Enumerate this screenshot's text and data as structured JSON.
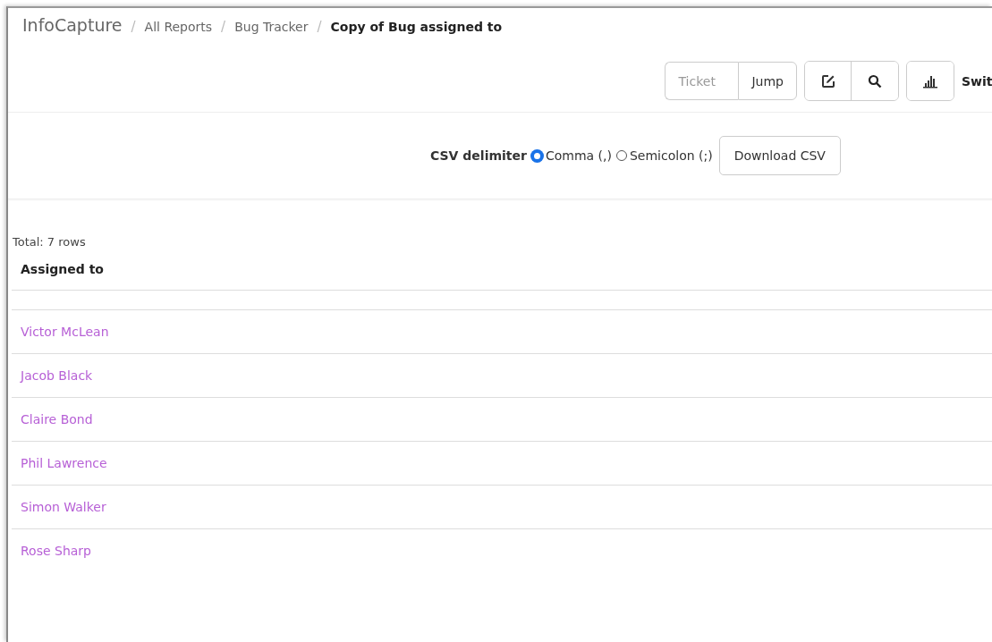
{
  "breadcrumb": [
    {
      "label": "InfoCapture",
      "kind": "brand"
    },
    {
      "label": "All Reports",
      "kind": "link"
    },
    {
      "label": "Bug Tracker",
      "kind": "link"
    },
    {
      "label": "Copy of Bug assigned to",
      "kind": "current"
    }
  ],
  "breadcrumb_separator": "/",
  "toolbar": {
    "ticket_placeholder": "Ticket",
    "jump_button": "Jump",
    "switch_label": "Swit"
  },
  "csv": {
    "label": "CSV delimiter",
    "options": [
      {
        "label": "Comma (,)",
        "selected": true
      },
      {
        "label": "Semicolon (;)",
        "selected": false
      }
    ],
    "download_button": "Download CSV"
  },
  "total": "Total: 7 rows",
  "table": {
    "columns": [
      "Assigned to"
    ],
    "rows": [
      {
        "assigned_to": "Victor McLean"
      },
      {
        "assigned_to": "Jacob Black"
      },
      {
        "assigned_to": "Claire Bond"
      },
      {
        "assigned_to": "Phil Lawrence"
      },
      {
        "assigned_to": "Simon Walker"
      },
      {
        "assigned_to": "Rose Sharp"
      }
    ]
  }
}
